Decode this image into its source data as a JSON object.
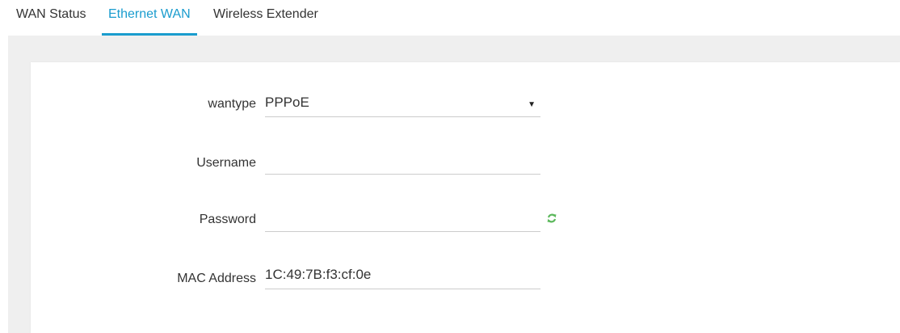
{
  "tabs": [
    {
      "label": "WAN Status",
      "active": false
    },
    {
      "label": "Ethernet WAN",
      "active": true
    },
    {
      "label": "Wireless Extender",
      "active": false
    }
  ],
  "form": {
    "wantype": {
      "label": "wantype",
      "value": "PPPoE"
    },
    "username": {
      "label": "Username",
      "value": "",
      "placeholder": ""
    },
    "password": {
      "label": "Password",
      "value": "",
      "placeholder": ""
    },
    "mac": {
      "label": "MAC Address",
      "value": "1C:49:7B:f3:cf:0e"
    }
  },
  "icons": {
    "dropdown": "triangle-down",
    "password_action": "refresh-icon"
  },
  "colors": {
    "accent": "#1a9cce",
    "refresh": "#5cb85c"
  }
}
